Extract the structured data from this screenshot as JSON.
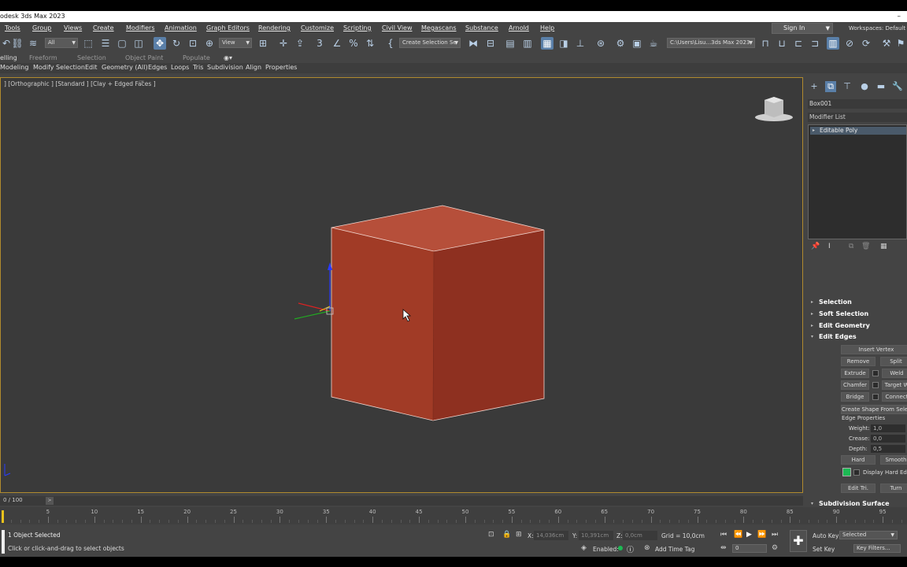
{
  "window": {
    "title": "odesk 3ds Max 2023",
    "minimize": "–"
  },
  "menu": [
    "Tools",
    "Group",
    "Views",
    "Create",
    "Modifiers",
    "Animation",
    "Graph Editors",
    "Rendering",
    "Customize",
    "Scripting",
    "Civil View",
    "Megascans",
    "Substance",
    "Arnold",
    "Help"
  ],
  "signin": {
    "label": "Sign In"
  },
  "workspaces": {
    "label": "Workspaces:",
    "value": "Default"
  },
  "toolbar": {
    "filter_value": "All",
    "refcoord_value": "View",
    "named_selection_value": "Create Selection Se",
    "project_path": "C:\\Users\\Lisu...3ds Max 2023"
  },
  "ribbon": {
    "tabs": [
      "elling",
      "Freeform",
      "Selection",
      "Object Paint",
      "Populate"
    ],
    "buttons": [
      "Modeling",
      "Modify Selection",
      "Edit",
      "Geometry (All)",
      "Edges",
      "Loops",
      "Tris",
      "Subdivision",
      "Align",
      "Properties"
    ]
  },
  "viewport": {
    "label": "] [Orthographic ] [Standard ] [Clay + Edged Faces ]",
    "colors": {
      "cube_top": "#b64f3a",
      "cube_left": "#a13b26",
      "cube_right": "#8e3020",
      "viewport_bg": "#3a3a3a",
      "border": "#b08a2e"
    }
  },
  "command_panel": {
    "object_name": "Box001",
    "modifier_list": "Modifier List",
    "stack_item": "Editable Poly",
    "rollouts": {
      "selection": "Selection",
      "soft_selection": "Soft Selection",
      "edit_geometry": "Edit Geometry",
      "edit_edges": "Edit Edges",
      "subdivision_surface": "Subdivision Surface"
    },
    "edit_edges": {
      "insert_vertex": "Insert Vertex",
      "remove": "Remove",
      "split": "Split",
      "extrude": "Extrude",
      "weld": "Weld",
      "chamfer": "Chamfer",
      "target_weld": "Target W",
      "bridge": "Bridge",
      "connect": "Connect",
      "create_shape": "Create Shape From Select",
      "edge_properties": "Edge Properties",
      "weight_label": "Weight:",
      "weight_value": "1,0",
      "crease_label": "Crease:",
      "crease_value": "0,0",
      "depth_label": "Depth:",
      "depth_value": "0,5",
      "hard": "Hard",
      "smooth": "Smooth",
      "display_hard_edges": "Display Hard Edge",
      "edit_tri": "Edit Tri.",
      "turn": "Turn"
    }
  },
  "time": {
    "slider_label": "0 / 100",
    "ticks": [
      5,
      10,
      15,
      20,
      25,
      30,
      35,
      40,
      45,
      50,
      55,
      60,
      65,
      70,
      75,
      80,
      85,
      90,
      95
    ]
  },
  "status": {
    "selection": "1 Object Selected",
    "prompt": "Click or click-and-drag to select objects",
    "x_label": "X:",
    "x_value": "14,036cm",
    "y_label": "Y:",
    "y_value": "10,391cm",
    "z_label": "Z:",
    "z_value": "0,0cm",
    "grid": "Grid = 10,0cm",
    "enabled": "Enabled:",
    "add_time_tag": "Add Time Tag",
    "auto_key": "Auto Key",
    "set_key": "Set Key",
    "selected_value": "Selected",
    "key_filters": "Key Filters...",
    "frame_value": "0"
  }
}
